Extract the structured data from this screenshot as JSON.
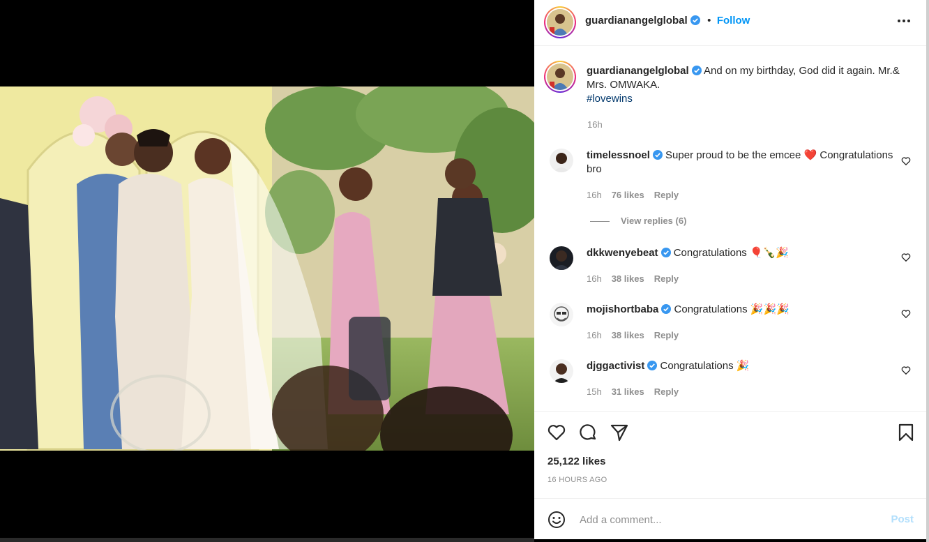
{
  "post": {
    "username": "guardianangelglobal",
    "follow_label": "Follow",
    "separator": "•",
    "caption": "And on my birthday, God did it again. Mr.& Mrs. OMWAKA.",
    "hashtag": "#lovewins",
    "caption_time": "16h"
  },
  "comments": [
    {
      "username": "timelessnoel",
      "text": "Super proud to be the emcee ❤️ Congratulations bro",
      "time": "16h",
      "likes": "76 likes",
      "reply": "Reply"
    },
    {
      "username": "dkkwenyebeat",
      "text": "Congratulations 🎈🍾🎉",
      "time": "16h",
      "likes": "38 likes",
      "reply": "Reply"
    },
    {
      "username": "mojishortbaba",
      "text": "Congratulations 🎉🎉🎉",
      "time": "16h",
      "likes": "38 likes",
      "reply": "Reply"
    },
    {
      "username": "djggactivist",
      "text": "Congratulations 🎉",
      "time": "15h",
      "likes": "31 likes",
      "reply": "Reply"
    }
  ],
  "view_replies": "View replies (6)",
  "likes_count": "25,122 likes",
  "posted_ago": "16 HOURS AGO",
  "add_comment": {
    "placeholder": "Add a comment...",
    "post_label": "Post"
  },
  "colors": {
    "accent": "#0095f6",
    "verified": "#3897f0",
    "hashtag": "#00376b"
  },
  "icons": [
    "more-options-icon",
    "verified-icon",
    "heart-icon",
    "comment-icon",
    "share-icon",
    "bookmark-icon",
    "emoji-icon"
  ]
}
